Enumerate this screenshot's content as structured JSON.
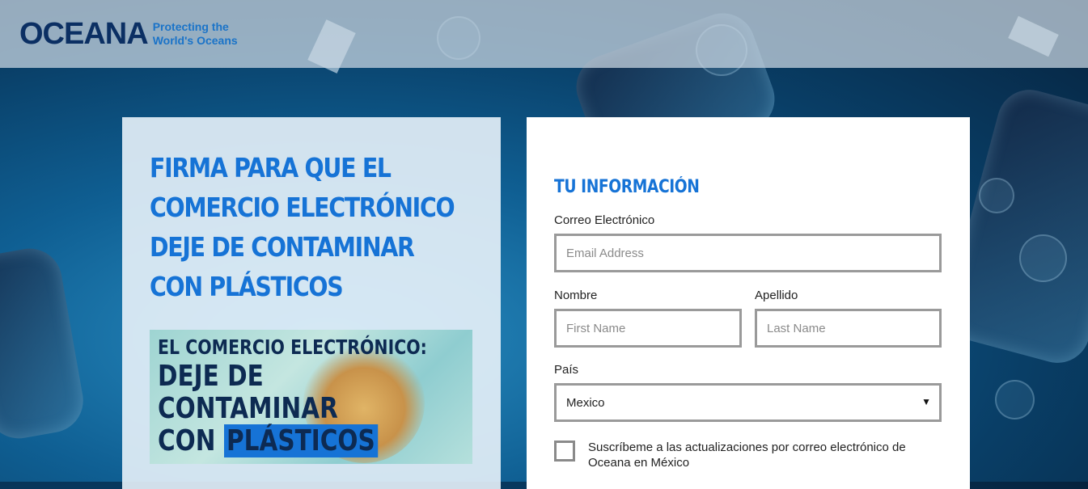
{
  "header": {
    "logo_text": "OCEANA",
    "tagline_line1": "Protecting the",
    "tagline_line2": "World's Oceans"
  },
  "hero": {
    "headline_lines": [
      "FIRMA PARA QUE EL",
      "COMERCIO ELECTRÓNICO",
      "DEJE DE CONTAMINAR",
      "CON PLÁSTICOS"
    ],
    "promo_line1": "EL COMERCIO ELECTRÓNICO:",
    "promo_line2": "DEJE DE",
    "promo_line3": "CONTAMINAR",
    "promo_line4_prefix": "CON",
    "promo_line4_highlight": "PLÁSTICOS"
  },
  "form": {
    "title": "TU INFORMACIÓN",
    "email_label": "Correo Electrónico",
    "email_placeholder": "Email Address",
    "first_name_label": "Nombre",
    "first_name_placeholder": "First Name",
    "last_name_label": "Apellido",
    "last_name_placeholder": "Last Name",
    "country_label": "País",
    "country_value": "Mexico",
    "subscribe_label": "Suscríbeme a las actualizaciones por correo electrónico de Oceana en México"
  },
  "colors": {
    "brand_blue": "#1673d6",
    "logo_navy": "#0b2f63",
    "input_border": "#9a9a9a"
  },
  "icons": {
    "dropdown": "caret-down-icon"
  }
}
